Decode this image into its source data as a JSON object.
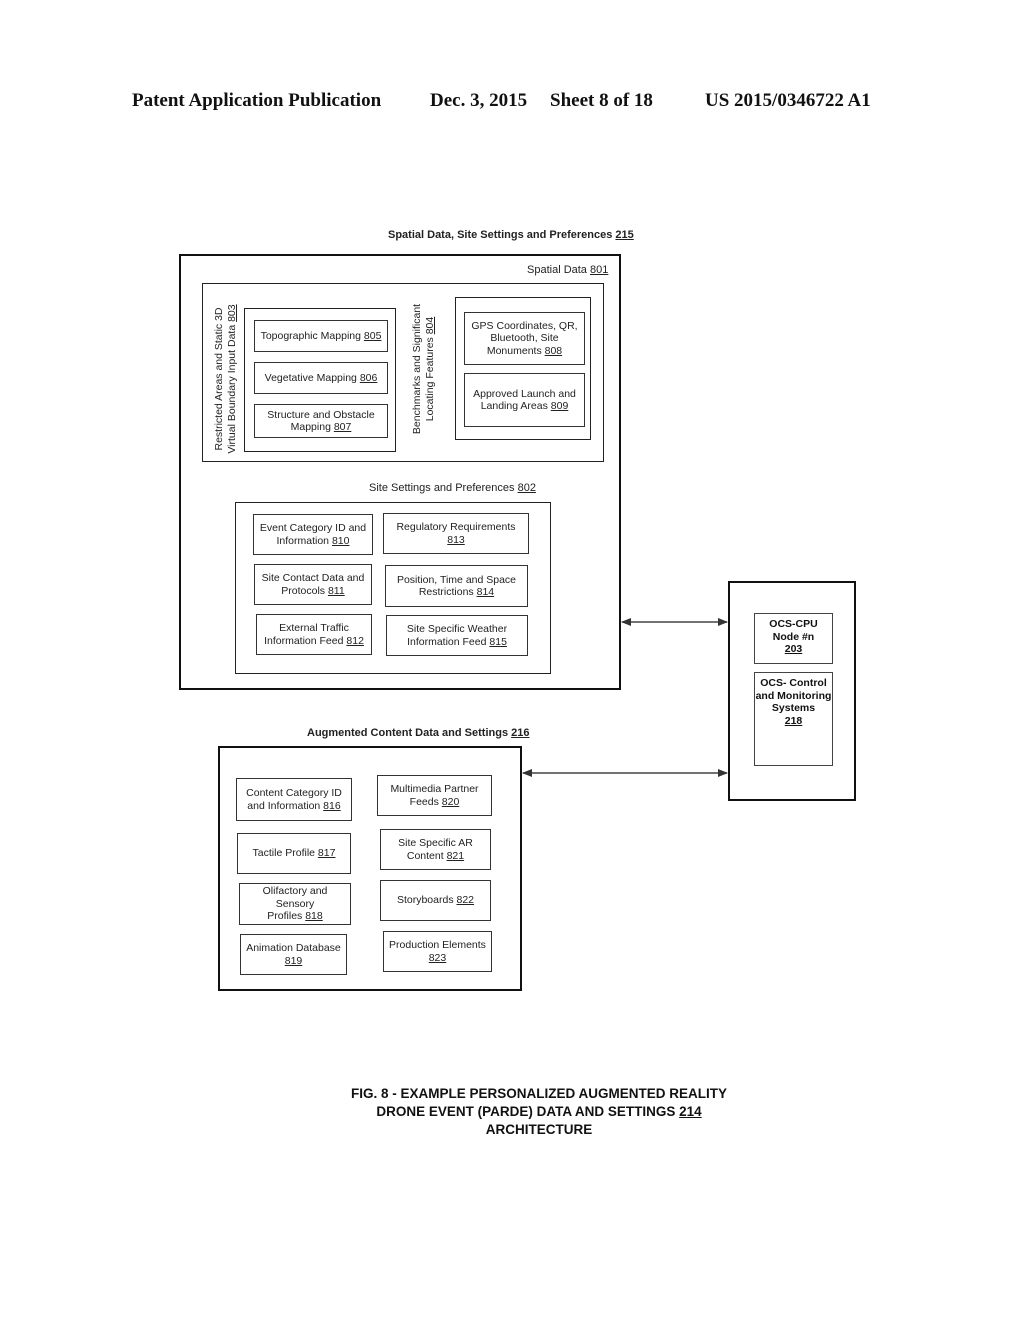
{
  "header": {
    "publication": "Patent Application Publication",
    "date": "Dec. 3, 2015",
    "sheet": "Sheet 8 of 18",
    "number": "US 2015/0346722 A1"
  },
  "spatial_group": {
    "title": "Spatial Data, Site Settings and Preferences",
    "ref": "215",
    "spatial_data": {
      "title": "Spatial Data",
      "ref": "801",
      "restricted": {
        "line1": "Restricted Areas and Static 3D",
        "line2": "Virtual Boundary Input Data",
        "ref": "803",
        "items": [
          {
            "text": "Topographic Mapping",
            "ref": "805"
          },
          {
            "text": "Vegetative Mapping",
            "ref": "806"
          },
          {
            "text1": "Structure and Obstacle",
            "text2": "Mapping",
            "ref": "807"
          }
        ]
      },
      "benchmarks": {
        "line1": "Benchmarks and Significant",
        "line2": "Locating Features",
        "ref": "804",
        "items": [
          {
            "text1": "GPS Coordinates, QR,",
            "text2": "Bluetooth, Site",
            "text3": "Monuments",
            "ref": "808"
          },
          {
            "text1": "Approved Launch and",
            "text2": "Landing Areas",
            "ref": "809"
          }
        ]
      }
    },
    "site_settings": {
      "title": "Site Settings and Preferences",
      "ref": "802",
      "items": [
        {
          "text1": "Event Category ID and",
          "text2": "Information",
          "ref": "810"
        },
        {
          "text1": "Regulatory Requirements",
          "text2": "",
          "ref": "813"
        },
        {
          "text1": "Site Contact Data and",
          "text2": "Protocols",
          "ref": "811"
        },
        {
          "text1": "Position, Time and Space",
          "text2": "Restrictions",
          "ref": "814"
        },
        {
          "text1": "External Traffic",
          "text2": "Information Feed",
          "ref": "812"
        },
        {
          "text1": "Site Specific Weather",
          "text2": "Information Feed",
          "ref": "815"
        }
      ]
    }
  },
  "augmented_group": {
    "title": "Augmented Content Data and Settings",
    "ref": "216",
    "items": [
      {
        "text1": "Content Category ID",
        "text2": "and Information",
        "ref": "816"
      },
      {
        "text1": "Multimedia Partner",
        "text2": "Feeds",
        "ref": "820"
      },
      {
        "text1": "Tactile Profile",
        "text2": "",
        "ref": "817"
      },
      {
        "text1": "Site Specific AR",
        "text2": "Content",
        "ref": "821"
      },
      {
        "text1": "Olifactory and Sensory",
        "text2": "Profiles",
        "ref": "818"
      },
      {
        "text1": "Storyboards",
        "text2": "",
        "ref": "822"
      },
      {
        "text1": "Animation Database",
        "text2": "",
        "ref": "819"
      },
      {
        "text1": "Production Elements",
        "text2": "",
        "ref": "823"
      }
    ]
  },
  "ocs": {
    "cpu": {
      "line1": "OCS-CPU",
      "line2": "Node #n",
      "ref": "203"
    },
    "control": {
      "line1": "OCS- Control",
      "line2": "and Monitoring",
      "line3": "Systems",
      "ref": "218"
    }
  },
  "caption": {
    "line1": "FIG. 8 - EXAMPLE PERSONALIZED AUGMENTED REALITY",
    "line2": "DRONE EVENT (PARDE) DATA AND SETTINGS",
    "ref": "214",
    "line3": "ARCHITECTURE"
  }
}
